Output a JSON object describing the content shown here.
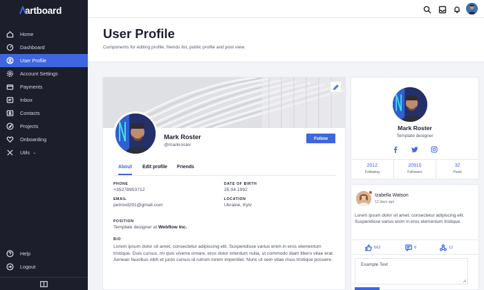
{
  "app": {
    "logo": "artboard"
  },
  "sidebar": {
    "items": [
      {
        "label": "Home",
        "icon": "home-icon"
      },
      {
        "label": "Dashboard",
        "icon": "dashboard-icon"
      },
      {
        "label": "User Profile",
        "icon": "user-icon",
        "active": true
      },
      {
        "label": "Account Settings",
        "icon": "gear-icon"
      },
      {
        "label": "Payments",
        "icon": "wallet-icon"
      },
      {
        "label": "Inbox",
        "icon": "inbox-icon"
      },
      {
        "label": "Contacts",
        "icon": "contacts-icon"
      },
      {
        "label": "Projects",
        "icon": "rocket-icon"
      },
      {
        "label": "Onboarding",
        "icon": "heart-icon"
      },
      {
        "label": "Utils",
        "icon": "tools-icon",
        "chevron": "⌄"
      }
    ],
    "bottom": [
      {
        "label": "Help",
        "icon": "help-icon"
      },
      {
        "label": "Logout",
        "icon": "logout-icon"
      }
    ]
  },
  "header": {
    "title": "User Profile",
    "subtitle": "Components for editing profile, friends list, public profile and post view."
  },
  "profile": {
    "name": "Mark Roster",
    "handle": "@markroster",
    "follow_label": "Follow",
    "tabs": [
      "About",
      "Edit profile",
      "Friends"
    ],
    "fields": {
      "phone_label": "PHONE",
      "phone": "+35278953712",
      "dob_label": "DATE OF BIRTH",
      "dob": "25.04.1992",
      "email_label": "EMAIL",
      "email": "petrovdz91@gmail.com",
      "location_label": "LOCATION",
      "location": "Ukraine, Kyiv",
      "position_label": "POSITION",
      "position_prefix": "Template designer at ",
      "position_company": "Webflow Inc.",
      "bio_label": "BIO",
      "bio": "Lorem ipsum dolor sit amet, consectetur adipiscing elit. Suspendisse varius enim in eros elementum tristique. Duis cursus, mi quis viverra ornare, eros dolor interdum nulla, ut commodo diam libero vitae erat. Aenean faucibus nibh et justo cursus id rutrum lorem imperdiet. Nunc ut sem vitae risus tristique posuere."
    }
  },
  "side_profile": {
    "name": "Mark Roster",
    "role": "Template designer",
    "socials": [
      "facebook-icon",
      "twitter-icon",
      "instagram-icon"
    ],
    "stats": [
      {
        "value": "2012",
        "label": "Following"
      },
      {
        "value": "20910",
        "label": "Followers"
      },
      {
        "value": "32",
        "label": "Posts"
      }
    ]
  },
  "post": {
    "author": "Izabella Watson",
    "time": "12 days ago",
    "body": "Lorem ipsum dolor sit amet, consectetur adipiscing elit. Suspendisse varius enim in eros elementum tristique.",
    "likes": "562",
    "comments": "8",
    "shares": "12",
    "comment_placeholder": "Example Text"
  },
  "colors": {
    "accent": "#3f66e0",
    "sidebar": "#1c1f2b",
    "notification": "#e0433c"
  }
}
